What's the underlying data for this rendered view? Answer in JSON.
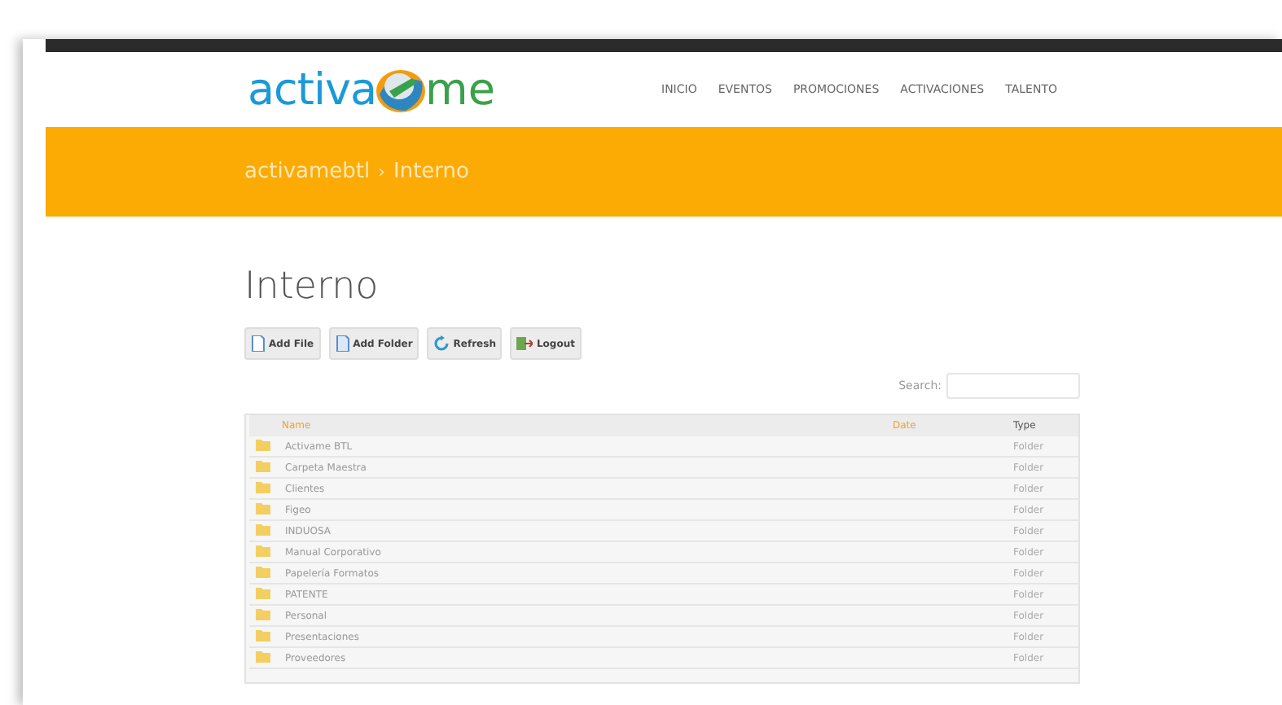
{
  "logo": {
    "left": "activa",
    "right": "me"
  },
  "nav": [
    "INICIO",
    "EVENTOS",
    "PROMOCIONES",
    "ACTIVACIONES",
    "TALENTO"
  ],
  "breadcrumb": {
    "parent": "activamebtl",
    "separator": "›",
    "current": "Interno"
  },
  "heading": "Interno",
  "buttons": [
    {
      "label": "Add File",
      "kind": "file"
    },
    {
      "label": "Add Folder",
      "kind": "folder"
    },
    {
      "label": "Refresh",
      "kind": "refresh"
    },
    {
      "label": "Logout",
      "kind": "logout"
    }
  ],
  "search": {
    "label": "Search:"
  },
  "table": {
    "columns": [
      "Name",
      "Date",
      "Type"
    ],
    "rows": [
      {
        "name": "Activame BTL",
        "type": "Folder"
      },
      {
        "name": "Carpeta Maestra",
        "type": "Folder"
      },
      {
        "name": "Clientes",
        "type": "Folder"
      },
      {
        "name": "Figeo",
        "type": "Folder"
      },
      {
        "name": "INDUOSA",
        "type": "Folder"
      },
      {
        "name": "Manual Corporativo",
        "type": "Folder"
      },
      {
        "name": "Papelería Formatos",
        "type": "Folder"
      },
      {
        "name": "PATENTE",
        "type": "Folder"
      },
      {
        "name": "Personal",
        "type": "Folder"
      },
      {
        "name": "Presentaciones",
        "type": "Folder"
      },
      {
        "name": "Proveedores",
        "type": "Folder"
      }
    ]
  }
}
